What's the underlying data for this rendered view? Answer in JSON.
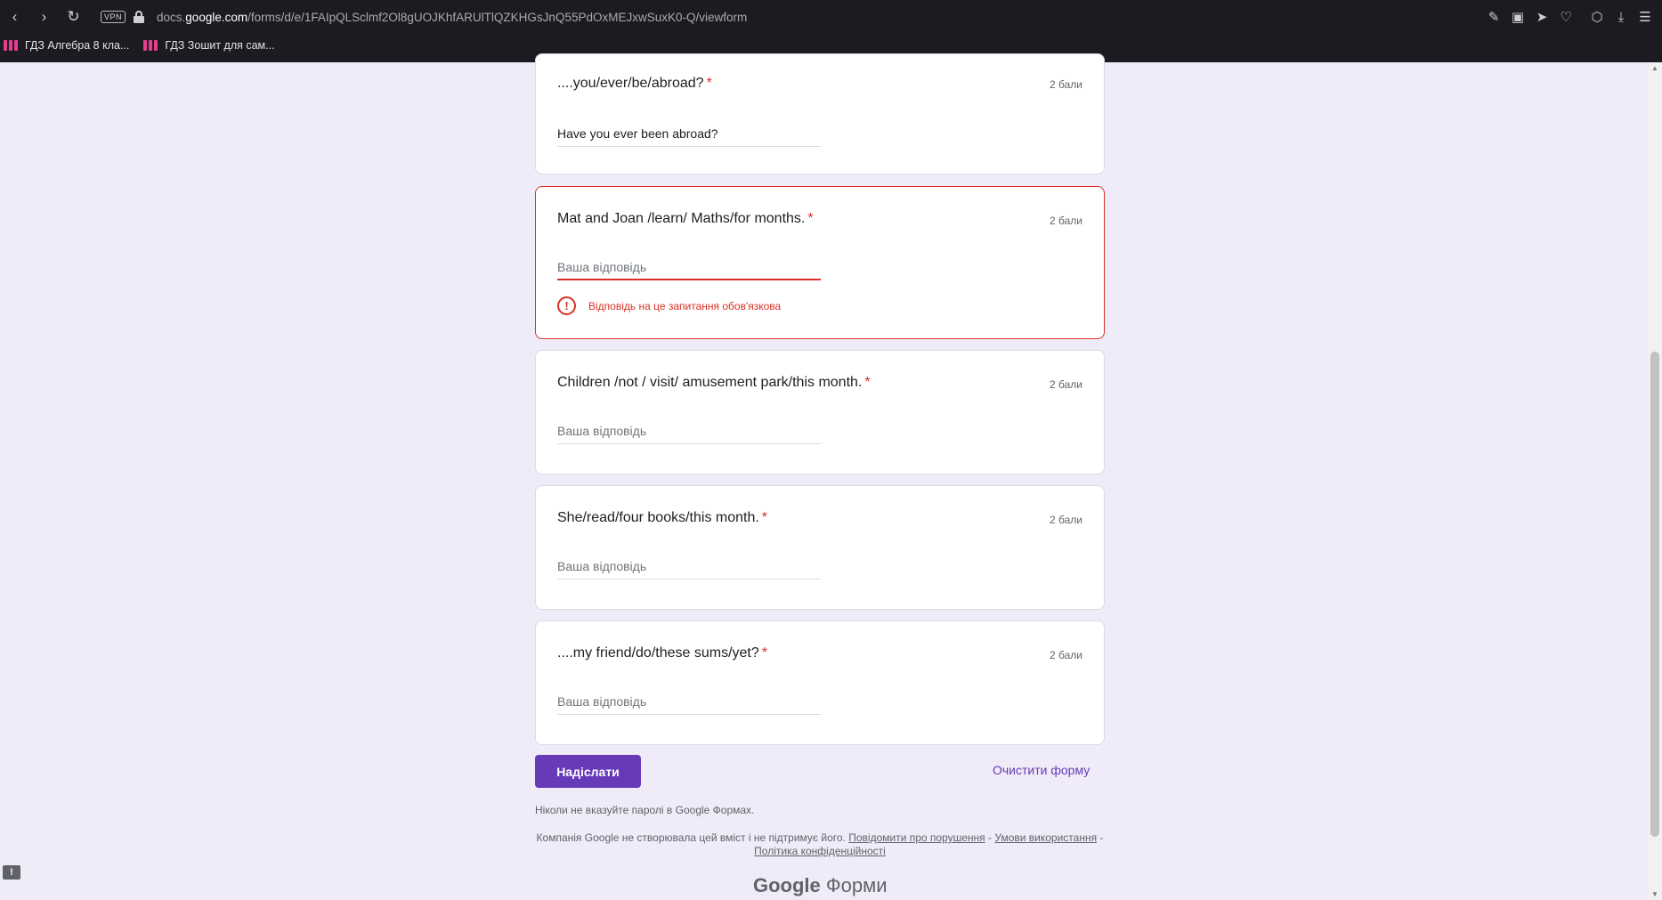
{
  "browser": {
    "vpn_label": "VPN",
    "url_prefix": "docs.",
    "url_host": "google.com",
    "url_path": "/forms/d/e/1FAIpQLSclmf2Ol8gUOJKhfARUlTlQZKHGsJnQ55PdOxMEJxwSuxK0-Q/viewform",
    "bookmarks": [
      {
        "label": "ГДЗ Алгебра 8 кла..."
      },
      {
        "label": "ГДЗ Зошит для сам..."
      }
    ],
    "colors": {
      "chrome": "#1c1b22",
      "bookmark_icon": "#e63d8f"
    }
  },
  "form": {
    "accent_color": "#673ab7",
    "error_color": "#d93025",
    "required_mark": "*",
    "questions": [
      {
        "title": "....you/ever/be/abroad?",
        "points": "2 бали",
        "answer": "Have you ever been abroad?",
        "placeholder": "Ваша відповідь"
      },
      {
        "title": "Mat and Joan /learn/ Maths/for months.",
        "points": "2 бали",
        "answer": "",
        "placeholder": "Ваша відповідь",
        "error": "Відповідь на це запитання обов'язкова"
      },
      {
        "title": "Children /not / visit/ amusement park/this month.",
        "points": "2 бали",
        "answer": "",
        "placeholder": "Ваша відповідь"
      },
      {
        "title": "She/read/four books/this month.",
        "points": "2 бали",
        "answer": "",
        "placeholder": "Ваша відповідь"
      },
      {
        "title": "....my friend/do/these sums/yet?",
        "points": "2 бали",
        "answer": "",
        "placeholder": "Ваша відповідь"
      }
    ],
    "submit_label": "Надіслати",
    "clear_label": "Очистити форму",
    "password_note": "Ніколи не вказуйте паролі в Google Формах.",
    "disclaimer": {
      "text": "Компанія Google не створювала цей вміст і не підтримує його.",
      "report_link": "Повідомити про порушення",
      "separator": " - ",
      "terms_link": "Умови використання",
      "privacy_link": "Політика конфіденційності"
    },
    "footer": {
      "brand": "Google",
      "product": "Форми"
    }
  }
}
